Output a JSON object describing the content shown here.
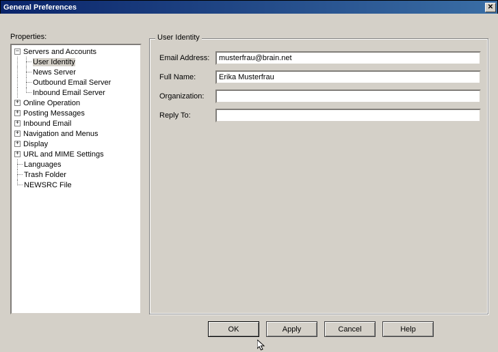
{
  "window": {
    "title": "General Preferences"
  },
  "propertiesLabel": "Properties:",
  "tree": {
    "serversAccounts": "Servers and Accounts",
    "userIdentity": "User Identity",
    "newsServer": "News Server",
    "outboundEmail": "Outbound Email Server",
    "inboundEmail": "Inbound Email Server",
    "onlineOperation": "Online Operation",
    "postingMessages": "Posting Messages",
    "inboundEmailTop": "Inbound Email",
    "navigation": "Navigation and Menus",
    "display": "Display",
    "urlMime": "URL and MIME Settings",
    "languages": "Languages",
    "trashFolder": "Trash Folder",
    "newsrc": "NEWSRC File"
  },
  "group": {
    "title": "User Identity"
  },
  "form": {
    "emailLabel": "Email Address:",
    "emailValue": "musterfrau@brain.net",
    "fullNameLabel": "Full Name:",
    "fullNameValue": "Erika Musterfrau",
    "orgLabel": "Organization:",
    "orgValue": "",
    "replyLabel": "Reply To:",
    "replyValue": ""
  },
  "buttons": {
    "ok": "OK",
    "apply": "Apply",
    "cancel": "Cancel",
    "help": "Help"
  }
}
